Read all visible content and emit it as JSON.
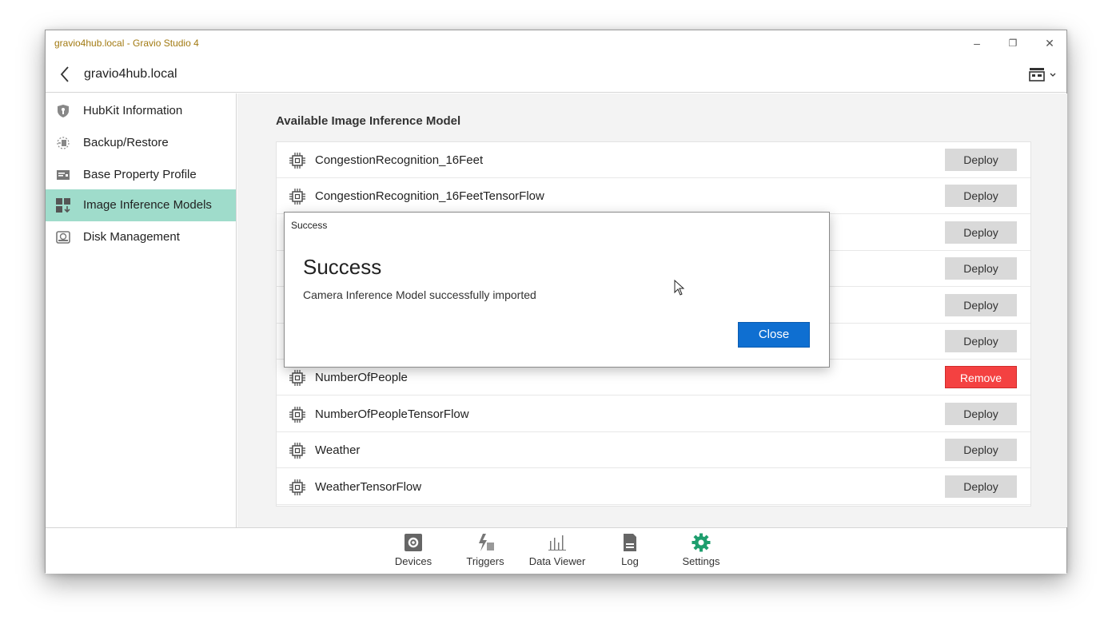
{
  "window": {
    "title": "gravio4hub.local - Gravio Studio 4",
    "controls": {
      "minimize": "–",
      "restore": "❐",
      "close": "✕"
    }
  },
  "navbar": {
    "title": "gravio4hub.local",
    "back_icon": "chevron-left-icon",
    "layout_icon": "layout-grid-icon"
  },
  "sidebar": {
    "items": [
      {
        "label": "HubKit Information",
        "icon": "shield-icon",
        "active": false
      },
      {
        "label": "Backup/Restore",
        "icon": "backup-icon",
        "active": false
      },
      {
        "label": "Base Property Profile",
        "icon": "profile-card-icon",
        "active": false
      },
      {
        "label": "Image Inference Models",
        "icon": "grid-download-icon",
        "active": true
      },
      {
        "label": "Disk Management",
        "icon": "disk-icon",
        "active": false
      }
    ]
  },
  "main": {
    "section_title": "Available Image Inference Model",
    "models": [
      {
        "name": "CongestionRecognition_16Feet",
        "action": "Deploy"
      },
      {
        "name": "CongestionRecognition_16FeetTensorFlow",
        "action": "Deploy"
      },
      {
        "name": "",
        "action": "Deploy"
      },
      {
        "name": "",
        "action": "Deploy"
      },
      {
        "name": "",
        "action": "Deploy"
      },
      {
        "name": "",
        "action": "Deploy"
      },
      {
        "name": "NumberOfPeople",
        "action": "Remove"
      },
      {
        "name": "NumberOfPeopleTensorFlow",
        "action": "Deploy"
      },
      {
        "name": "Weather",
        "action": "Deploy"
      },
      {
        "name": "WeatherTensorFlow",
        "action": "Deploy"
      }
    ]
  },
  "bottom_tabs": [
    {
      "label": "Devices",
      "icon": "devices-gear-icon"
    },
    {
      "label": "Triggers",
      "icon": "triggers-bolt-icon"
    },
    {
      "label": "Data Viewer",
      "icon": "bar-chart-icon"
    },
    {
      "label": "Log",
      "icon": "log-document-icon"
    },
    {
      "label": "Settings",
      "icon": "settings-gear-icon"
    }
  ],
  "dialog": {
    "caption": "Success",
    "heading": "Success",
    "message": "Camera Inference Model successfully imported",
    "close_label": "Close"
  },
  "colors": {
    "accent_active": "#9fdccb",
    "settings_green": "#1e9e6e",
    "remove_red": "#f44141",
    "close_blue": "#0f6fd1",
    "title_gold": "#a27a12"
  }
}
